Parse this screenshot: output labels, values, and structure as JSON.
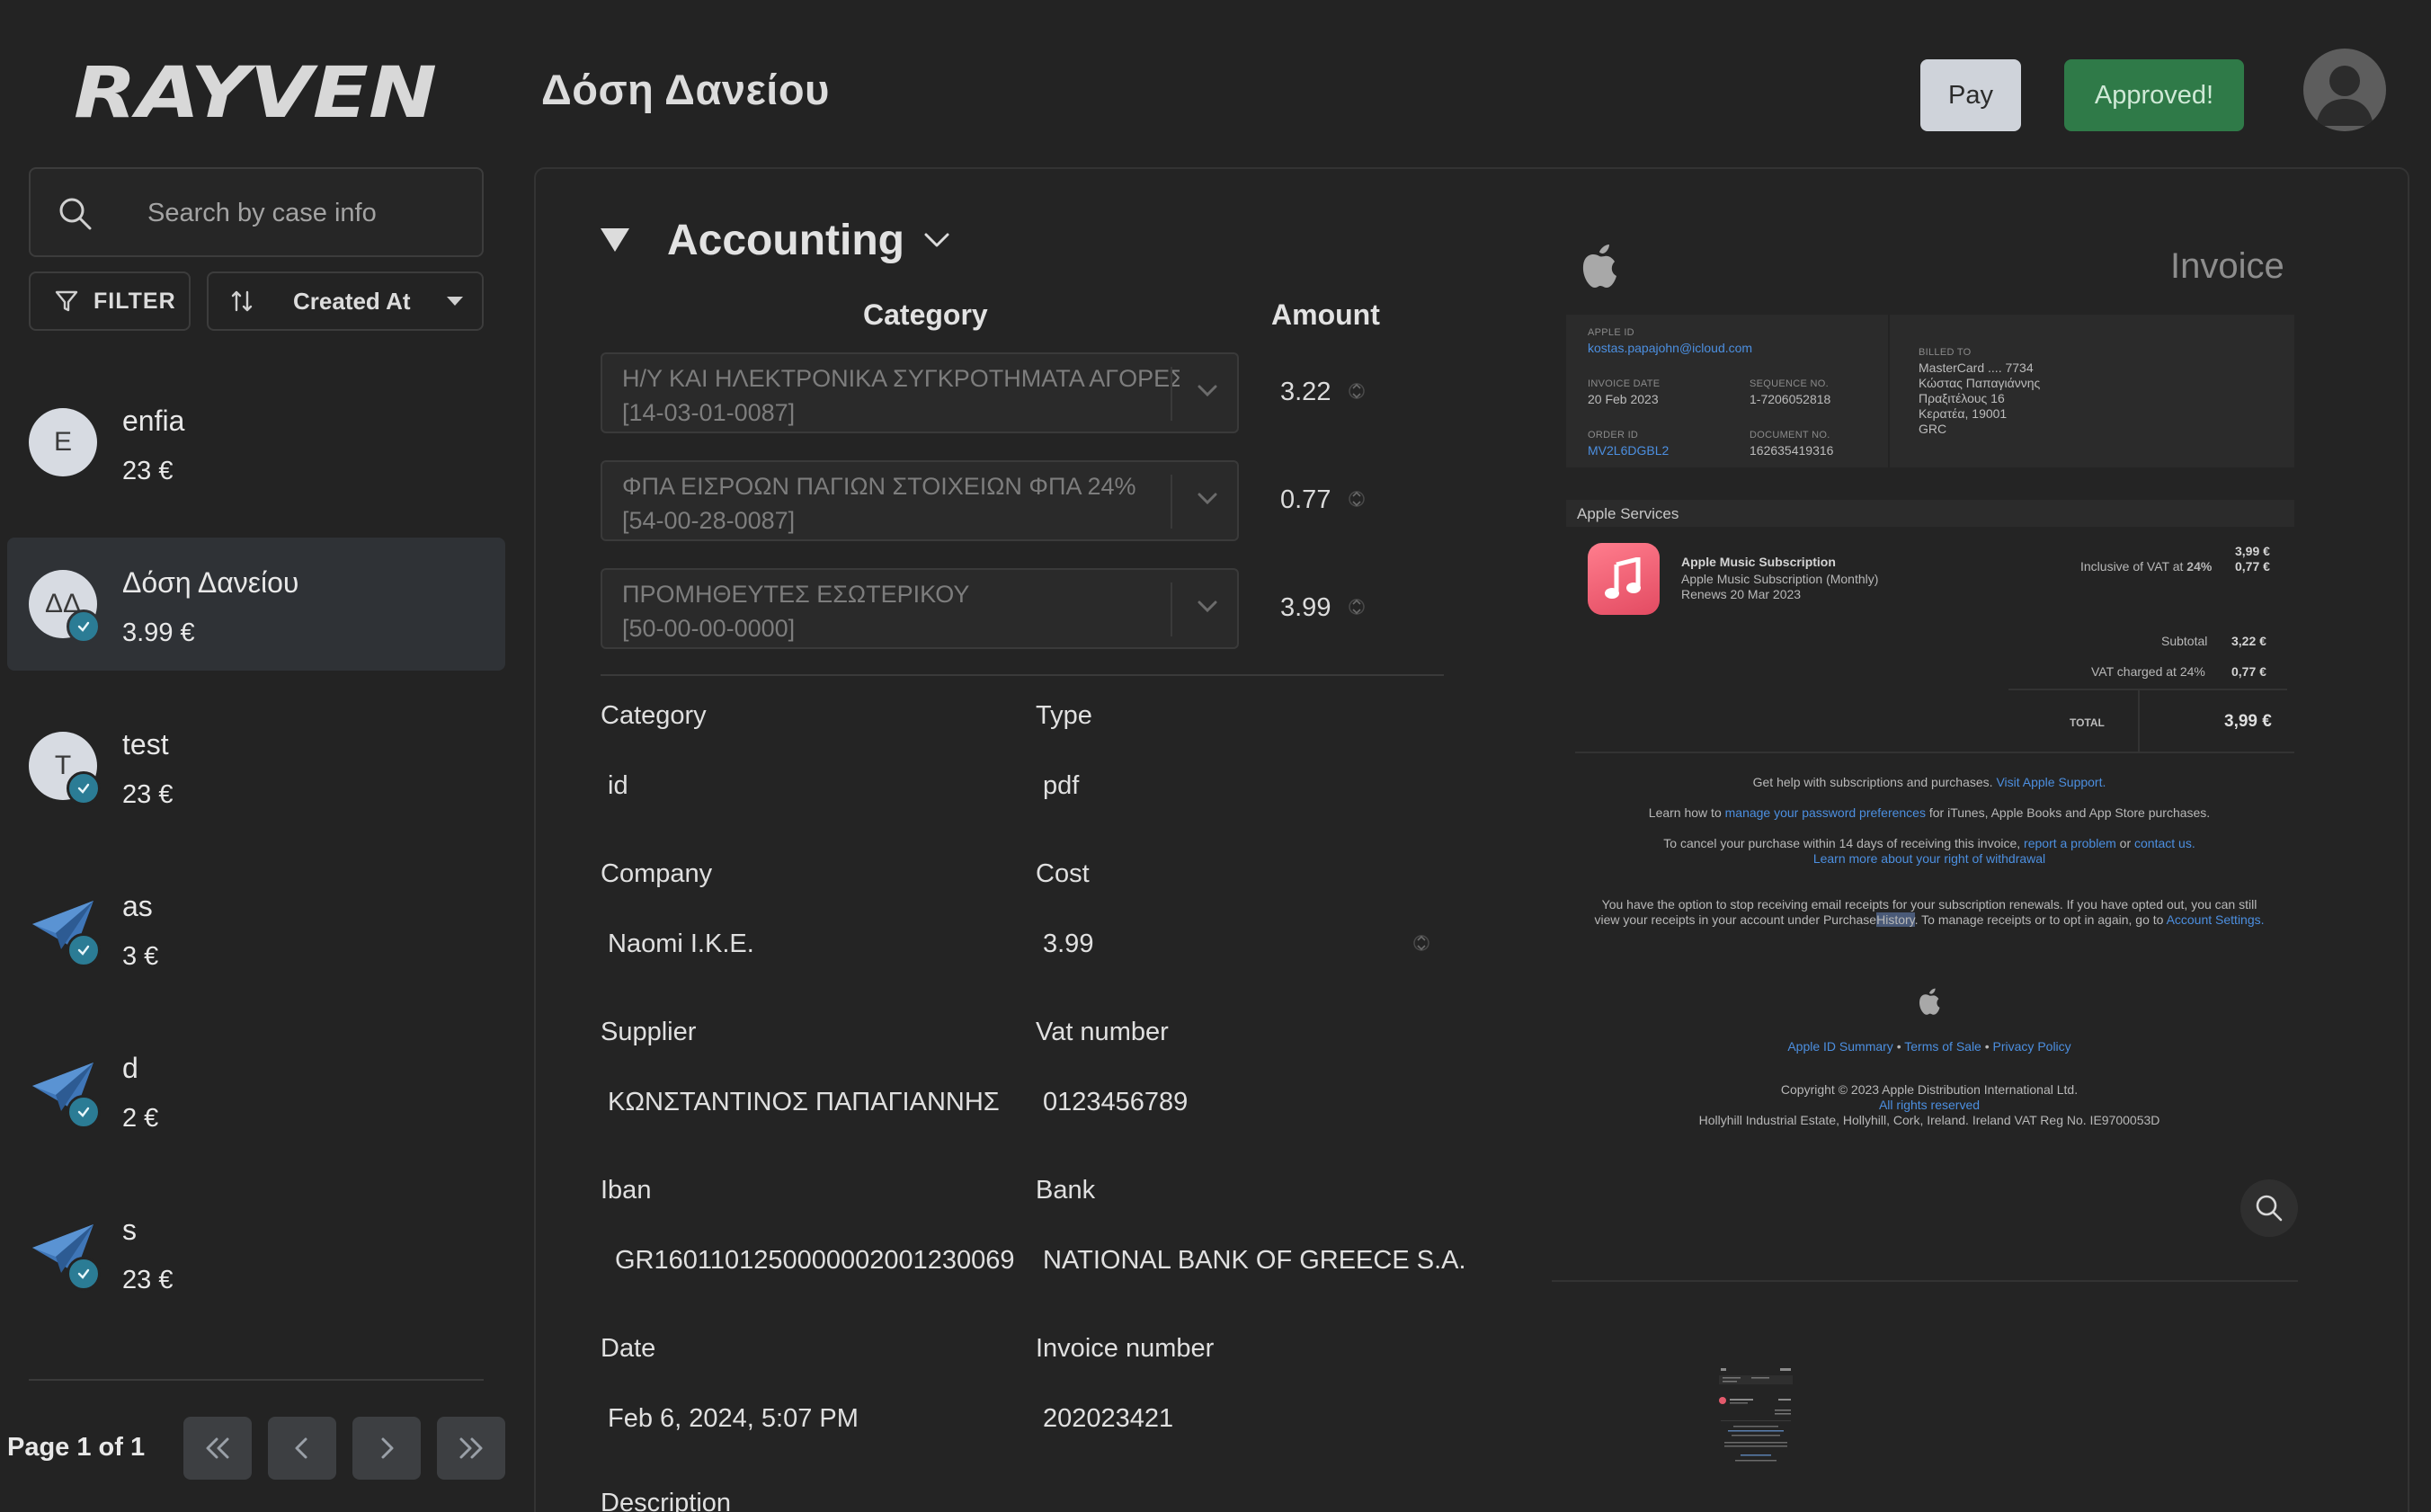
{
  "app": {
    "logo_text": "RAYVEN",
    "page_title": "Δόση Δανείου"
  },
  "header": {
    "pay_label": "Pay",
    "approved_label": "Approved!"
  },
  "sidebar": {
    "search_placeholder": "Search by case info",
    "filter_label": "FILTER",
    "sort_label": "Created At",
    "cases": [
      {
        "name": "enfia",
        "amount": "23 €",
        "avatar": "E",
        "icon": "letter-avatar",
        "checked": false
      },
      {
        "name": "Δόση Δανείου",
        "amount": "3.99 €",
        "avatar": "ΔΔ",
        "icon": "letter-avatar",
        "checked": true
      },
      {
        "name": "test",
        "amount": "23 €",
        "avatar": "T",
        "icon": "letter-avatar",
        "checked": true
      },
      {
        "name": "as",
        "amount": "3 €",
        "avatar": "",
        "icon": "paper-plane-icon",
        "checked": true
      },
      {
        "name": "d",
        "amount": "2 €",
        "avatar": "",
        "icon": "paper-plane-icon",
        "checked": true
      },
      {
        "name": "s",
        "amount": "23 €",
        "avatar": "",
        "icon": "paper-plane-icon",
        "checked": true
      }
    ],
    "page_info": "Page 1 of 1"
  },
  "accounting": {
    "title": "Accounting",
    "category_header": "Category",
    "amount_header": "Amount",
    "lines": [
      {
        "category": "Η/Υ ΚΑΙ ΗΛΕΚΤΡΟΝΙΚΑ ΣΥΓΚΡΟΤΗΜΑΤΑ ΑΓΟΡΕΣ",
        "code": "[14-03-01-0087]",
        "amount": "3.22"
      },
      {
        "category": "ΦΠΑ ΕΙΣΡΟΩΝ ΠΑΓΙΩΝ ΣΤΟΙΧΕΙΩΝ ΦΠΑ 24%",
        "code": "[54-00-28-0087]",
        "amount": "0.77"
      },
      {
        "category": "ΠΡΟΜΗΘΕΥΤΕΣ ΕΣΩΤΕΡΙΚΟΥ",
        "code": "[50-00-00-0000]",
        "amount": "3.99"
      }
    ]
  },
  "fields": {
    "category_label": "Category",
    "category_value": "id",
    "type_label": "Type",
    "type_value": "pdf",
    "company_label": "Company",
    "company_value": "Naomi I.K.E.",
    "cost_label": "Cost",
    "cost_value": "3.99",
    "supplier_label": "Supplier",
    "supplier_value": "ΚΩΝΣΤΑΝΤΙΝΟΣ ΠΑΠΑΓΙΑΝΝΗΣ",
    "vat_label": "Vat number",
    "vat_value": "0123456789",
    "iban_label": "Iban",
    "iban_value": "GR1601101250000002001230069",
    "bank_label": "Bank",
    "bank_value": "NATIONAL BANK OF GREECE S.A.",
    "date_label": "Date",
    "date_value": "Feb 6, 2024, 5:07 PM",
    "invoice_number_label": "Invoice number",
    "invoice_number_value": "202023421",
    "description_label": "Description"
  },
  "invoice": {
    "title": "Invoice",
    "apple_id_label": "APPLE ID",
    "apple_id_value": "kostas.papajohn@icloud.com",
    "billed_to_label": "BILLED TO",
    "billed_to_lines": [
      "MasterCard .... 7734",
      "Κώστας Παπαγιάννης",
      "Πραξιτέλους 16",
      "Κερατέα, 19001",
      "GRC"
    ],
    "invoice_date_label": "INVOICE DATE",
    "invoice_date_value": "20 Feb 2023",
    "sequence_label": "SEQUENCE NO.",
    "sequence_value": "1-7206052818",
    "order_id_label": "ORDER ID",
    "order_id_value": "MV2L6DGBL2",
    "document_label": "DOCUMENT NO.",
    "document_value": "162635419316",
    "services_title": "Apple Services",
    "item_name": "Apple Music Subscription",
    "item_sub": "Apple Music Subscription (Monthly)",
    "item_renews": "Renews 20 Mar 2023",
    "item_vat_note_prefix": "Inclusive of VAT at",
    "item_vat_rate": "24%",
    "item_price": "3,99 €",
    "item_vat": "0,77 €",
    "subtotal_label": "Subtotal",
    "subtotal_value": "3,22 €",
    "vat_charged_label": "VAT charged at 24%",
    "vat_charged_value": "0,77 €",
    "total_label": "TOTAL",
    "total_value": "3,99 €",
    "help_text": "Get help with subscriptions and purchases.",
    "help_link": "Visit Apple Support.",
    "password_prefix": "Learn how to",
    "password_link": "manage your password preferences",
    "password_suffix": "for iTunes, Apple Books and App Store purchases.",
    "cancel_text": "To cancel your purchase within 14 days of receiving this invoice,",
    "report_link": "report a problem",
    "or_text": "or",
    "contact_link": "contact us.",
    "withdrawal_link": "Learn more about your right of withdrawal",
    "optout_line1": "You have the option to stop receiving email receipts for your subscription renewals. If you have opted out, you can still",
    "optout_line2_prefix": "view your receipts in your account under Purchase",
    "history_word": "History",
    "optout_line2_mid": ". To manage receipts or to opt in again, go to",
    "account_settings_link": "Account Settings.",
    "summary_link": "Apple ID Summary",
    "terms_link": "Terms of Sale",
    "privacy_link": "Privacy Policy",
    "bullet": "•",
    "copyright": "Copyright © 2023 Apple Distribution International Ltd.",
    "rights_link": "All rights reserved",
    "address": "Hollyhill Industrial Estate, Hollyhill, Cork, Ireland. Ireland VAT Reg No. IE9700053D"
  },
  "colors": {
    "background": "#232323",
    "approved": "#2f7a48",
    "pay": "#cfd3da",
    "check_badge": "#2b7c95",
    "link": "#4c8fe0"
  }
}
